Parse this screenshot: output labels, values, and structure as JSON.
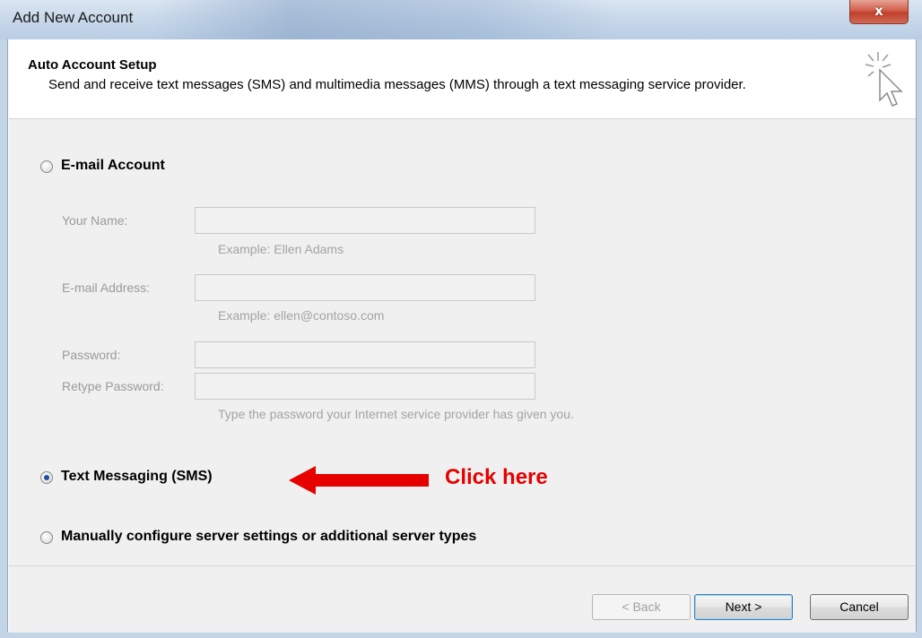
{
  "window": {
    "title": "Add New Account",
    "close_glyph": "x"
  },
  "header": {
    "title": "Auto Account Setup",
    "subtitle": "Send and receive text messages (SMS) and multimedia messages (MMS) through a text messaging service provider.",
    "icon": "wizard-cursor-icon"
  },
  "email_account": {
    "label": "E-mail Account",
    "selected": false,
    "enabled": false,
    "fields": [
      {
        "label": "Your Name:",
        "value": "",
        "hint": "Example: Ellen Adams"
      },
      {
        "label": "E-mail Address:",
        "value": "",
        "hint": "Example: ellen@contoso.com"
      },
      {
        "label": "Password:",
        "value": ""
      },
      {
        "label": "Retype Password:",
        "value": "",
        "hint": "Type the password your Internet service provider has given you."
      }
    ]
  },
  "options": {
    "sms_label": "Text Messaging (SMS)",
    "sms_selected": true,
    "manual_label": "Manually configure server settings or additional server types",
    "manual_selected": false
  },
  "annotation": {
    "text": "Click here",
    "color": "#e60000",
    "icon": "arrow-left-icon"
  },
  "footer": {
    "back_label": "< Back",
    "back_enabled": false,
    "next_label": "Next >",
    "cancel_label": "Cancel"
  },
  "colors": {
    "accent": "#1f4fa0",
    "close_button": "#c0402c"
  }
}
